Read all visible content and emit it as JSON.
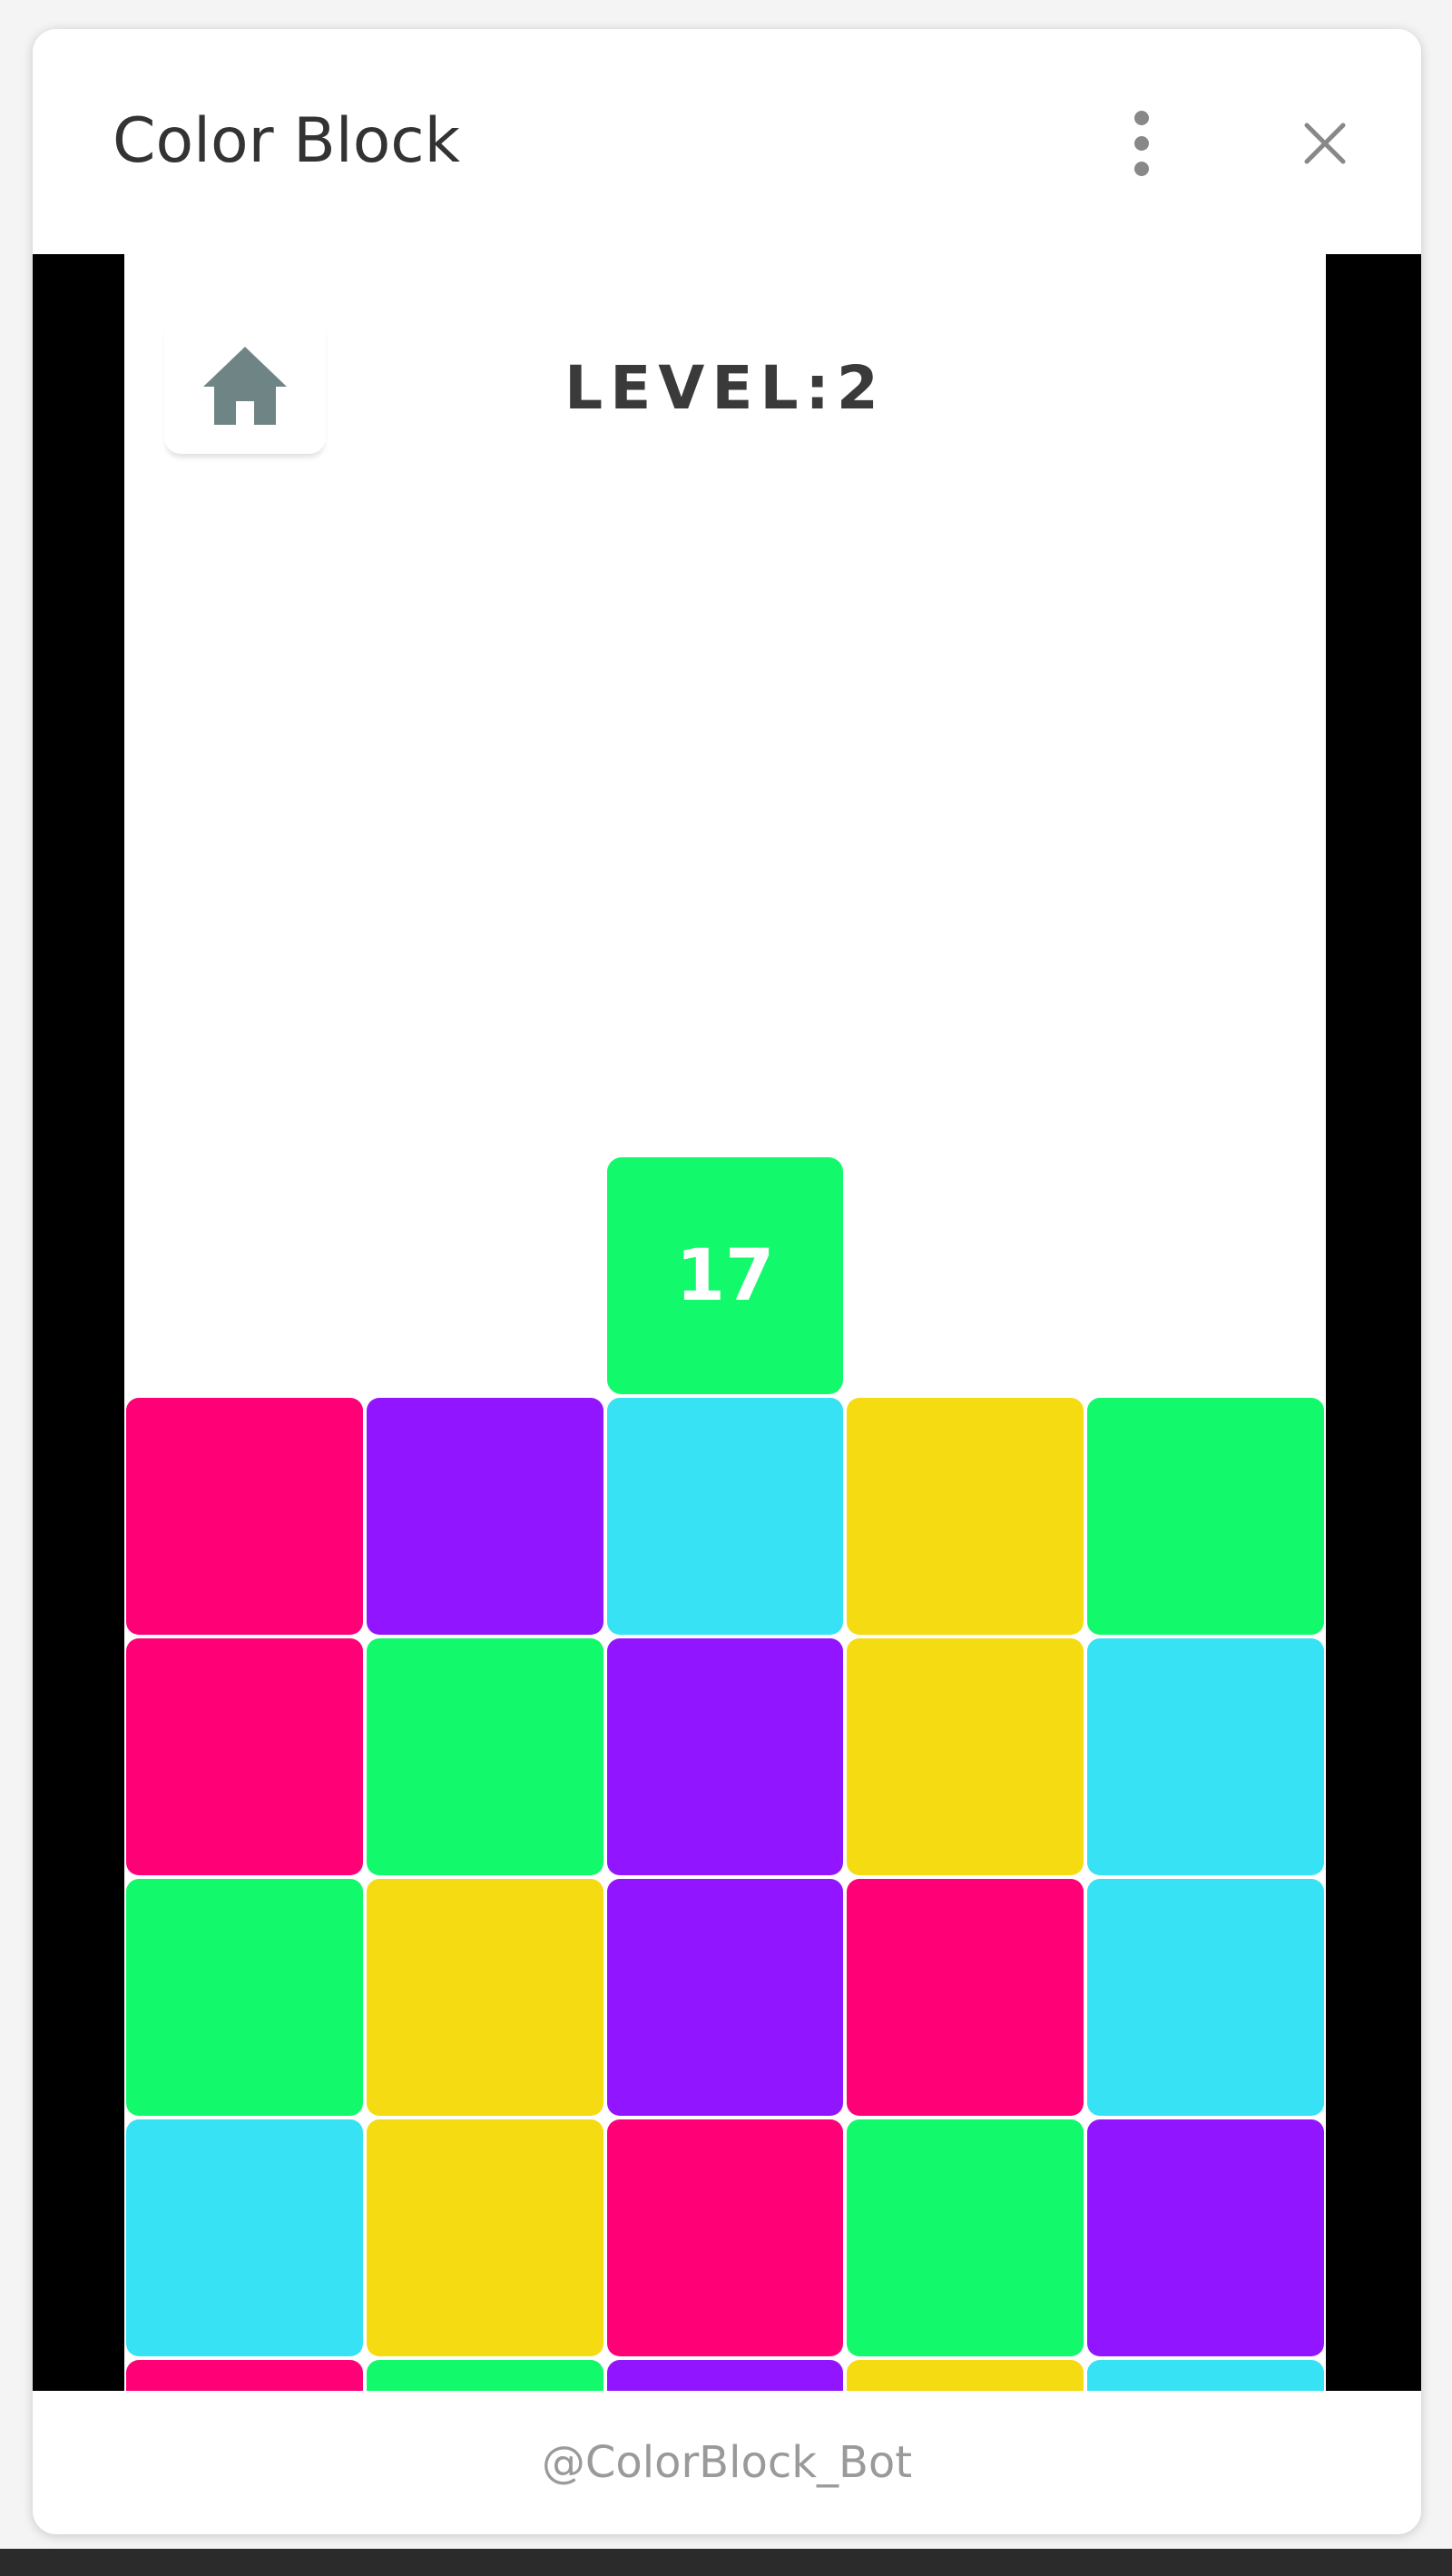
{
  "window": {
    "title": "Color Block"
  },
  "game": {
    "level_text": "LEVEL:2",
    "current_block": {
      "number": "17",
      "color": "#12f96b",
      "column": 2
    },
    "grid": [
      [
        "#ff0077",
        "#9116ff",
        "#36e2f4",
        "#f5dc12",
        "#12f96b"
      ],
      [
        "#ff0077",
        "#12f96b",
        "#9116ff",
        "#f5dc12",
        "#36e2f4"
      ],
      [
        "#12f96b",
        "#f5dc12",
        "#9116ff",
        "#ff0077",
        "#36e2f4"
      ],
      [
        "#36e2f4",
        "#f5dc12",
        "#ff0077",
        "#12f96b",
        "#9116ff"
      ],
      [
        "#ff0077",
        "#12f96b",
        "#9116ff",
        "#f5dc12",
        "#36e2f4"
      ]
    ],
    "colors": {
      "pink": "#ff0077",
      "purple": "#9116ff",
      "cyan": "#36e2f4",
      "yellow": "#f5dc12",
      "green": "#12f96b"
    }
  },
  "footer": {
    "bot_handle": "@ColorBlock_Bot"
  },
  "icons": {
    "menu": "kebab-menu-icon",
    "close": "close-icon",
    "home": "home-icon"
  },
  "theme": {
    "home_icon_color": "#6f8585",
    "side_bar_color": "#000000"
  }
}
